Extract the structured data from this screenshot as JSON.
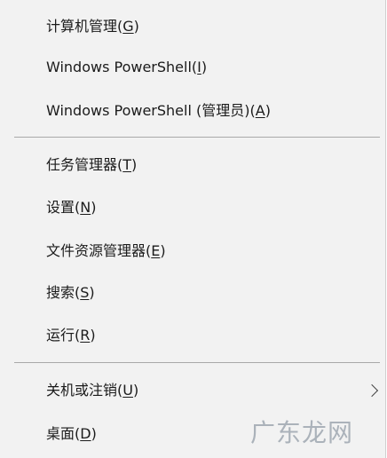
{
  "menu": {
    "items": [
      {
        "label": "计算机管理(",
        "accel": "G",
        "tail": ")"
      },
      {
        "label": "Windows PowerShell(",
        "accel": "I",
        "tail": ")"
      },
      {
        "label": "Windows PowerShell (管理员)(",
        "accel": "A",
        "tail": ")"
      },
      {
        "label": "任务管理器(",
        "accel": "T",
        "tail": ")"
      },
      {
        "label": "设置(",
        "accel": "N",
        "tail": ")"
      },
      {
        "label": "文件资源管理器(",
        "accel": "E",
        "tail": ")"
      },
      {
        "label": "搜索(",
        "accel": "S",
        "tail": ")"
      },
      {
        "label": "运行(",
        "accel": "R",
        "tail": ")"
      },
      {
        "label": "关机或注销(",
        "accel": "U",
        "tail": ")"
      },
      {
        "label": "桌面(",
        "accel": "D",
        "tail": ")"
      }
    ]
  },
  "watermark": "广东龙网",
  "colors": {
    "background": "#f2f2f2",
    "text": "#1b1b1b",
    "separator": "#a9a9a9"
  },
  "icons": {
    "submenu_arrow": "chevron-right-icon"
  }
}
